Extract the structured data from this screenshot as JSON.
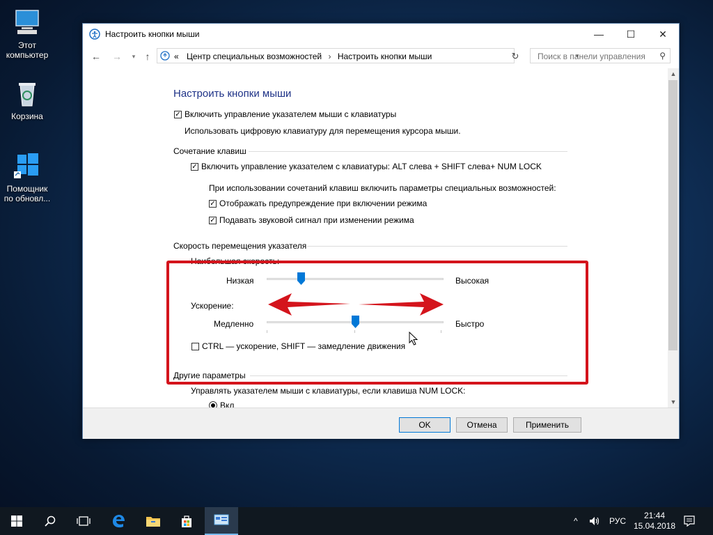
{
  "desktop": {
    "icons": [
      {
        "label_line1": "Этот",
        "label_line2": "компьютер"
      },
      {
        "label_line1": "Корзина",
        "label_line2": ""
      },
      {
        "label_line1": "Помощник",
        "label_line2": "по обновл..."
      }
    ]
  },
  "window": {
    "title": "Настроить кнопки мыши",
    "minimize_glyph": "—",
    "maximize_glyph": "☐",
    "close_glyph": "✕",
    "address": {
      "prefix": "«",
      "crumb1": "Центр специальных возможностей",
      "separator": "›",
      "crumb2": "Настроить кнопки мыши"
    },
    "search_placeholder": "Поиск в панели управления",
    "content": {
      "heading": "Настроить кнопки мыши",
      "enable_mousekeys": {
        "label": "Включить управление указателем мыши с клавиатуры",
        "checked": true
      },
      "enable_desc": "Использовать цифровую клавиатуру для перемещения курсора мыши.",
      "shortcut_group": "Сочетание клавиш",
      "shortcut_enable": {
        "label": "Включить управление указателем с клавиатуры: ALT слева + SHIFT слева+ NUM LOCK",
        "checked": true
      },
      "shortcut_desc": "При использовании сочетаний клавиш включить параметры специальных возможностей:",
      "warn_on": {
        "label": "Отображать предупреждение при включении режима",
        "checked": true
      },
      "sound_on": {
        "label": "Подавать звуковой сигнал при изменении режима",
        "checked": true
      },
      "speed_group": "Скорость перемещения указателя",
      "top_speed_label": "Наибольшая скорость:",
      "top_speed_min": "Низкая",
      "top_speed_max": "Высокая",
      "top_speed_value": 0.18,
      "accel_label": "Ускорение:",
      "accel_min": "Медленно",
      "accel_max": "Быстро",
      "accel_value": 0.5,
      "ctrl_shift": {
        "label": "CTRL — ускорение, SHIFT — замедление движения",
        "checked": false
      },
      "other_group": "Другие параметры",
      "numlock_desc": "Управлять указателем мыши с клавиатуры, если клавиша NUM LOCK:",
      "numlock_on": "Вкл"
    },
    "buttons": {
      "ok": "OK",
      "cancel": "Отмена",
      "apply": "Применить"
    }
  },
  "taskbar": {
    "language": "РУС",
    "time": "21:44",
    "date": "15.04.2018"
  },
  "colors": {
    "accent": "#0078d7",
    "highlight_red": "#d4141c",
    "heading_blue": "#1e3287"
  }
}
